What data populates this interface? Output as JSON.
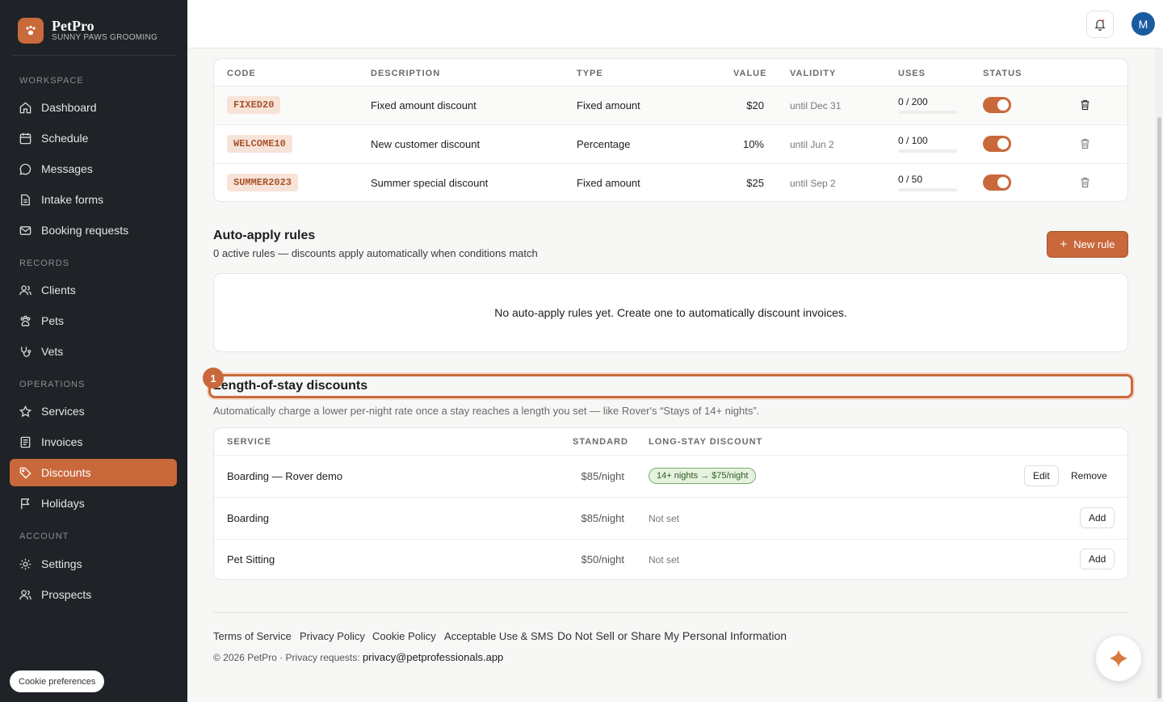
{
  "brand": {
    "name": "PetPro",
    "subtitle": "SUNNY PAWS GROOMING"
  },
  "sidebar": {
    "sections": {
      "workspace": "WORKSPACE",
      "records": "RECORDS",
      "operations": "OPERATIONS",
      "account": "ACCOUNT"
    },
    "items": [
      {
        "label": "Dashboard",
        "icon": "home-icon"
      },
      {
        "label": "Schedule",
        "icon": "calendar-icon"
      },
      {
        "label": "Messages",
        "icon": "chat-icon"
      },
      {
        "label": "Intake forms",
        "icon": "document-icon"
      },
      {
        "label": "Booking requests",
        "icon": "mail-icon"
      },
      {
        "label": "Clients",
        "icon": "users-icon"
      },
      {
        "label": "Pets",
        "icon": "paw-icon"
      },
      {
        "label": "Vets",
        "icon": "stethoscope-icon"
      },
      {
        "label": "Services",
        "icon": "star-icon"
      },
      {
        "label": "Invoices",
        "icon": "invoice-icon"
      },
      {
        "label": "Discounts",
        "icon": "tag-icon",
        "active": true
      },
      {
        "label": "Holidays",
        "icon": "flag-icon"
      },
      {
        "label": "Settings",
        "icon": "gear-icon"
      },
      {
        "label": "Prospects",
        "icon": "users-icon"
      }
    ],
    "cookie_button": "Cookie preferences"
  },
  "topbar": {
    "avatar_initial": "M",
    "bell_icon": "bell-icon"
  },
  "codes_table": {
    "headers": {
      "code": "CODE",
      "description": "DESCRIPTION",
      "type": "TYPE",
      "value": "VALUE",
      "validity": "VALIDITY",
      "uses": "USES",
      "status": "STATUS"
    },
    "rows": [
      {
        "code": "FIXED20",
        "description": "Fixed amount discount",
        "type": "Fixed amount",
        "value": "$20",
        "validity": "until Dec 31",
        "uses": "0 / 200",
        "active": true
      },
      {
        "code": "WELCOME10",
        "description": "New customer discount",
        "type": "Percentage",
        "value": "10%",
        "validity": "until Jun 2",
        "uses": "0 / 100",
        "active": true
      },
      {
        "code": "SUMMER2023",
        "description": "Summer special discount",
        "type": "Fixed amount",
        "value": "$25",
        "validity": "until Sep 2",
        "uses": "0 / 50",
        "active": true
      }
    ]
  },
  "auto_rules": {
    "title": "Auto-apply rules",
    "subtitle": "0 active rules — discounts apply automatically when conditions match",
    "new_rule_label": "New rule",
    "empty_message": "No auto-apply rules yet. Create one to automatically discount invoices."
  },
  "length_of_stay": {
    "marker": "1",
    "title": "Length-of-stay discounts",
    "subtitle": "Automatically charge a lower per-night rate once a stay reaches a length you set — like Rover's “Stays of 14+ nights”.",
    "headers": {
      "service": "SERVICE",
      "standard": "STANDARD",
      "discount": "LONG-STAY DISCOUNT"
    },
    "rows": [
      {
        "service": "Boarding — Rover demo",
        "standard": "$85/night",
        "discount": "14+ nights → $75/night",
        "edit": "Edit",
        "remove": "Remove"
      },
      {
        "service": "Boarding",
        "standard": "$85/night",
        "discount": "Not set",
        "add": "Add"
      },
      {
        "service": "Pet Sitting",
        "standard": "$50/night",
        "discount": "Not set",
        "add": "Add"
      }
    ]
  },
  "footer": {
    "links": [
      "Terms of Service",
      "Privacy Policy",
      "Cookie Policy",
      "Acceptable Use & SMS",
      "Do Not Sell or Share My Personal Information"
    ],
    "copyright": "© 2026 PetPro · Privacy requests:",
    "email": "privacy@petprofessionals.app"
  },
  "colors": {
    "accent": "#c8683b",
    "sidebar_bg": "#1f2226",
    "avatar": "#1a5aa0"
  }
}
